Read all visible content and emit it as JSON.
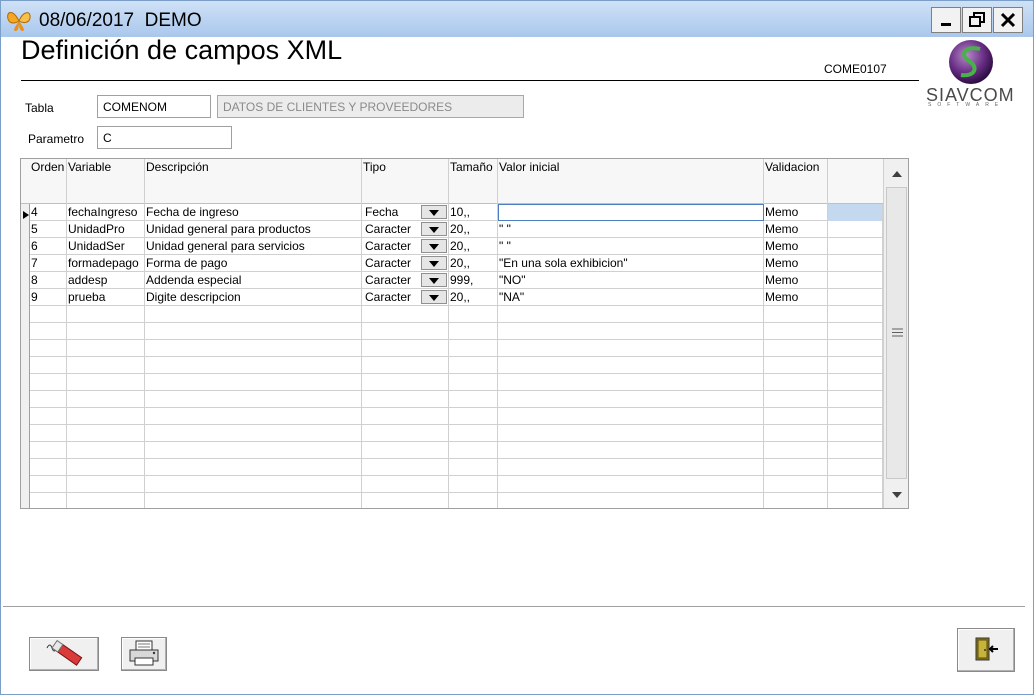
{
  "window": {
    "title": "08/06/2017  DEMO"
  },
  "page": {
    "title": "Definición de campos XML",
    "form_code": "COME0107",
    "logo_text": "SIAVCOM",
    "logo_subtext": "SOFTWARE"
  },
  "form": {
    "tabla_label": "Tabla",
    "tabla_value": "COMENOM",
    "tabla_desc": "DATOS DE CLIENTES Y PROVEEDORES",
    "parametro_label": "Parametro",
    "parametro_value": "C"
  },
  "grid": {
    "headers": [
      "Orden",
      "Variable",
      "Descripción",
      "Tipo",
      "Tamaño",
      "Valor inicial",
      "Validacion"
    ],
    "rows": [
      {
        "orden": "4",
        "variable": "fechaIngreso",
        "descripcion": "Fecha de ingreso",
        "tipo": "Fecha",
        "tamano": "10,,",
        "valor": "",
        "validacion": "Memo"
      },
      {
        "orden": "5",
        "variable": "UnidadPro",
        "descripcion": "Unidad general para productos",
        "tipo": "Caracter",
        "tamano": "20,,",
        "valor": "\" \"",
        "validacion": "Memo"
      },
      {
        "orden": "6",
        "variable": "UnidadSer",
        "descripcion": "Unidad general para servicios",
        "tipo": "Caracter",
        "tamano": "20,,",
        "valor": "\" \"",
        "validacion": "Memo"
      },
      {
        "orden": "7",
        "variable": "formadepago",
        "descripcion": "Forma de pago",
        "tipo": "Caracter",
        "tamano": "20,,",
        "valor": "\"En una sola exhibicion\"",
        "validacion": "Memo"
      },
      {
        "orden": "8",
        "variable": "addesp",
        "descripcion": "Addenda especial",
        "tipo": "Caracter",
        "tamano": "999,",
        "valor": "\"NO\"",
        "validacion": "Memo"
      },
      {
        "orden": "9",
        "variable": "prueba",
        "descripcion": "Digite descripcion",
        "tipo": "Caracter",
        "tamano": "20,,",
        "valor": "\"NA\"",
        "validacion": "Memo"
      }
    ],
    "empty_rows": 12
  },
  "colors": {
    "titlebar_top": "#cfe1f6",
    "titlebar_bottom": "#a9c7ec",
    "selection": "#c4d8ef",
    "active_border": "#4a7ec0"
  },
  "icons": {
    "app": "butterfly-icon",
    "minimize": "minimize-icon",
    "restore": "restore-icon",
    "close": "close-icon",
    "edit": "pencil-eraser-icon",
    "print": "printer-icon",
    "exit": "exit-door-icon"
  }
}
